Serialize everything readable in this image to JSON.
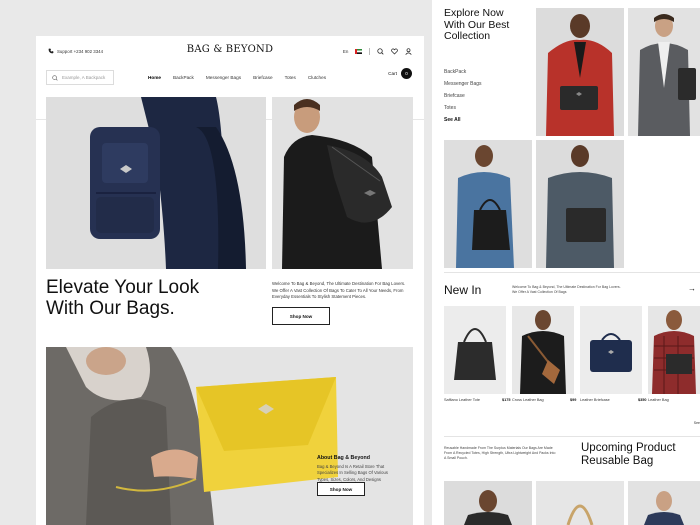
{
  "brand": {
    "logo": "BAG & BEYOND"
  },
  "topbar": {
    "support_label": "Support +234 902 3344",
    "language": "En"
  },
  "search": {
    "placeholder": "Example, A Backpack"
  },
  "nav": {
    "items": [
      {
        "label": "Home"
      },
      {
        "label": "BackPack"
      },
      {
        "label": "Messenger Bags"
      },
      {
        "label": "Briefcase"
      },
      {
        "label": "Totes"
      },
      {
        "label": "Clutches"
      }
    ],
    "active": "Home"
  },
  "cart": {
    "label": "Cart",
    "count": "0"
  },
  "hero": {
    "title_line1": "Elevate Your Look",
    "title_line2": "With Our Bags.",
    "description": "Welcome To Bag & Beyond, The Ultimate Destination For Bag Lovers. We Offer A Vast Collection Of Bags To Cater To All Your Needs, From Everyday Essentials To Stylish Statement Pieces.",
    "cta": "Shop Now"
  },
  "about": {
    "title": "About Bag & Beyond",
    "text": "Bag & Beyond Is A Retail Store That Specializes In Selling Bags Of Various Types, Sizes, Colors, And Designs",
    "cta": "Shop Now"
  },
  "explore": {
    "title_line1": "Explore Now",
    "title_line2": "With Our Best",
    "title_line3": "Collection",
    "categories": [
      "BackPack",
      "Messenger Bags",
      "Briefcase",
      "Totes"
    ],
    "see_all": "See All"
  },
  "new_in": {
    "title": "New In",
    "description": "Welcome To Bag & Beyond, The Ultimate Destination For Bag Lovers. We Offer A Vast Collection Of Bags",
    "arrow": "→",
    "products": [
      {
        "name": "Saffiano Leather Tote",
        "price": "$175"
      },
      {
        "name": "Cross Leather Bag",
        "price": "$99"
      },
      {
        "name": "Leather Briefcase",
        "price": "$350"
      },
      {
        "name": "Leather Bag",
        "price": ""
      }
    ],
    "see_more": "See"
  },
  "upcoming": {
    "description": "Reusable Handmade From The Surplus Materials Our Bags Are Made From A Recycled Totes, High Strength, Ultra Lightweight And Packs Into A Small Pouch.",
    "title_line1": "Upcoming Product",
    "title_line2": "Reusable Bag"
  },
  "colors": {
    "bag_yellow": "#f0d23c",
    "jacket_red": "#b8322a",
    "bag_navy": "#1f2d4d",
    "text_dark": "#111111"
  },
  "icons": [
    "phone-icon",
    "flag-icon",
    "search-icon",
    "heart-icon",
    "user-icon",
    "cart-icon"
  ]
}
